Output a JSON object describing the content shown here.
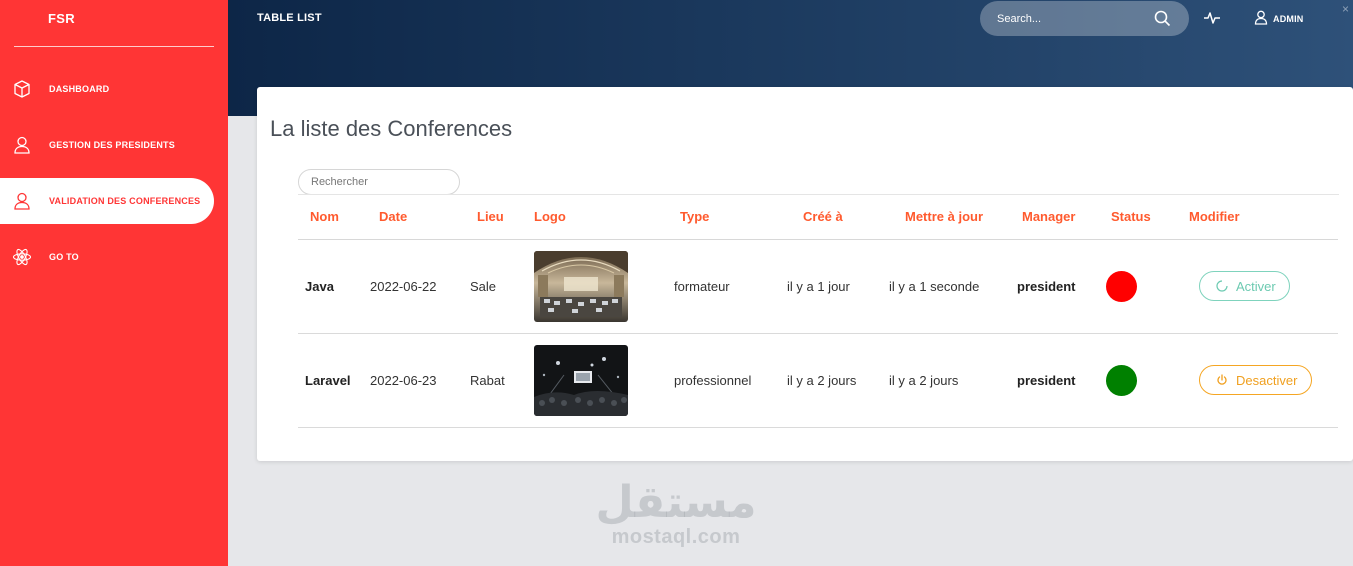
{
  "sidebar": {
    "brand": "FSR",
    "items": [
      {
        "label": "DASHBOARD",
        "icon": "cube-icon"
      },
      {
        "label": "GESTION DES PRESIDENTS",
        "icon": "user-icon"
      },
      {
        "label": "VALIDATION DES CONFERENCES",
        "icon": "user-icon",
        "active": true
      },
      {
        "label": "GO TO",
        "icon": "atom-icon"
      }
    ]
  },
  "header": {
    "title": "TABLE LIST",
    "search_placeholder": "Search...",
    "user_label": "ADMIN",
    "close_glyph": "×"
  },
  "main": {
    "title": "La liste des Conferences",
    "filter_placeholder": "Rechercher",
    "columns": [
      "Nom",
      "Date",
      "Lieu",
      "Logo",
      "Type",
      "Créé à",
      "Mettre à jour",
      "Manager",
      "Status",
      "Modifier"
    ],
    "rows": [
      {
        "nom": "Java",
        "date": "2022-06-22",
        "lieu": "Sale",
        "type": "formateur",
        "cree": "il y a 1 jour",
        "maj": "il y a 1 seconde",
        "manager": "president",
        "status_color": "#ff0000",
        "action": "Activer"
      },
      {
        "nom": "Laravel",
        "date": "2022-06-23",
        "lieu": "Rabat",
        "type": "professionnel",
        "cree": "il y a 2 jours",
        "maj": "il y a 2 jours",
        "manager": "president",
        "status_color": "#008000",
        "action": "Desactiver"
      }
    ]
  },
  "watermark": {
    "arabic": "مستقل",
    "latin": "mostaql.com"
  },
  "colors": {
    "sidebar": "#ff3535",
    "header_dark": "#0d2647",
    "accent_header": "#ff5a2e",
    "activer": "#6ccab1",
    "desactiver": "#f0a020"
  }
}
